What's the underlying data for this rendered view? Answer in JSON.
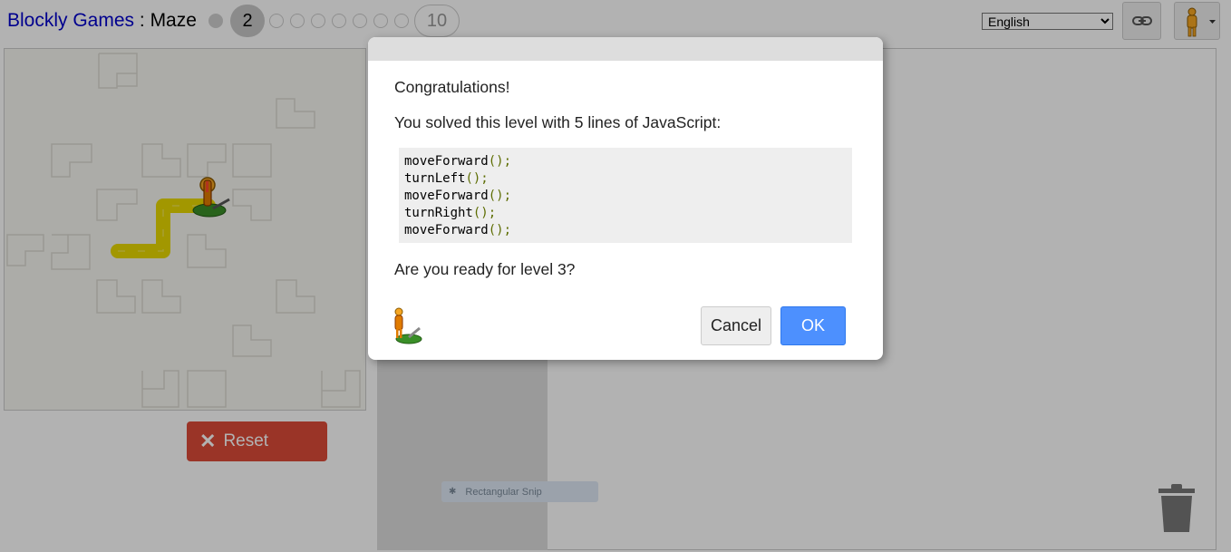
{
  "header": {
    "app_name": "Blockly Games",
    "separator": " : ",
    "game_name": "Maze",
    "levels": {
      "current_label": "2",
      "last_label": "10"
    },
    "language": "English"
  },
  "controls": {
    "reset_label": "Reset"
  },
  "overlay_snippet": {
    "label": "Rectangular Snip"
  },
  "dialog": {
    "congrats": "Congratulations!",
    "solved_text": "You solved this level with 5 lines of JavaScript:",
    "code_lines": [
      {
        "name": "moveForward",
        "parens": "();"
      },
      {
        "name": "turnLeft",
        "parens": "();"
      },
      {
        "name": "moveForward",
        "parens": "();"
      },
      {
        "name": "turnRight",
        "parens": "();"
      },
      {
        "name": "moveForward",
        "parens": "();"
      }
    ],
    "next_prompt": "Are you ready for level 3?",
    "cancel_label": "Cancel",
    "ok_label": "OK"
  },
  "colors": {
    "title_link": "#0000cc",
    "reset_button": "#dd4b39",
    "ok_button": "#4d90fe",
    "path": "#e8d800",
    "code_parens": "#5c6c00"
  },
  "icons": {
    "reset": "close-x-icon",
    "link": "link-icon",
    "user": "pegman-icon",
    "trash": "trash-icon"
  }
}
